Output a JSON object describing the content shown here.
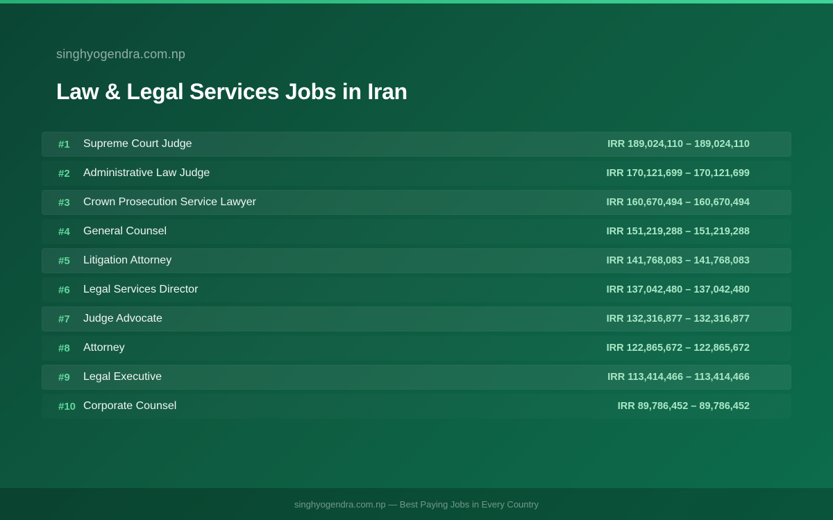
{
  "header": {
    "site": "singhyogendra.com.np",
    "title": "Law & Legal Services Jobs in Iran"
  },
  "jobs": [
    {
      "rank": "#1",
      "title": "Supreme Court Judge",
      "salary": "IRR 189,024,110 – 189,024,110"
    },
    {
      "rank": "#2",
      "title": "Administrative Law Judge",
      "salary": "IRR 170,121,699 – 170,121,699"
    },
    {
      "rank": "#3",
      "title": "Crown Prosecution Service Lawyer",
      "salary": "IRR 160,670,494 – 160,670,494"
    },
    {
      "rank": "#4",
      "title": "General Counsel",
      "salary": "IRR 151,219,288 – 151,219,288"
    },
    {
      "rank": "#5",
      "title": "Litigation Attorney",
      "salary": "IRR 141,768,083 – 141,768,083"
    },
    {
      "rank": "#6",
      "title": "Legal Services Director",
      "salary": "IRR 137,042,480 – 137,042,480"
    },
    {
      "rank": "#7",
      "title": "Judge Advocate",
      "salary": "IRR 132,316,877 – 132,316,877"
    },
    {
      "rank": "#8",
      "title": "Attorney",
      "salary": "IRR 122,865,672 – 122,865,672"
    },
    {
      "rank": "#9",
      "title": "Legal Executive",
      "salary": "IRR 113,414,466 – 113,414,466"
    },
    {
      "rank": "#10",
      "title": "Corporate Counsel",
      "salary": "IRR 89,786,452 – 89,786,452"
    }
  ],
  "footer": {
    "text": "singhyogendra.com.np — Best Paying Jobs in Every Country"
  },
  "colors": {
    "accent": "#3fd598",
    "rank": "#5fd89c",
    "salary": "#a8e7c6",
    "background": "#0e5a40"
  }
}
